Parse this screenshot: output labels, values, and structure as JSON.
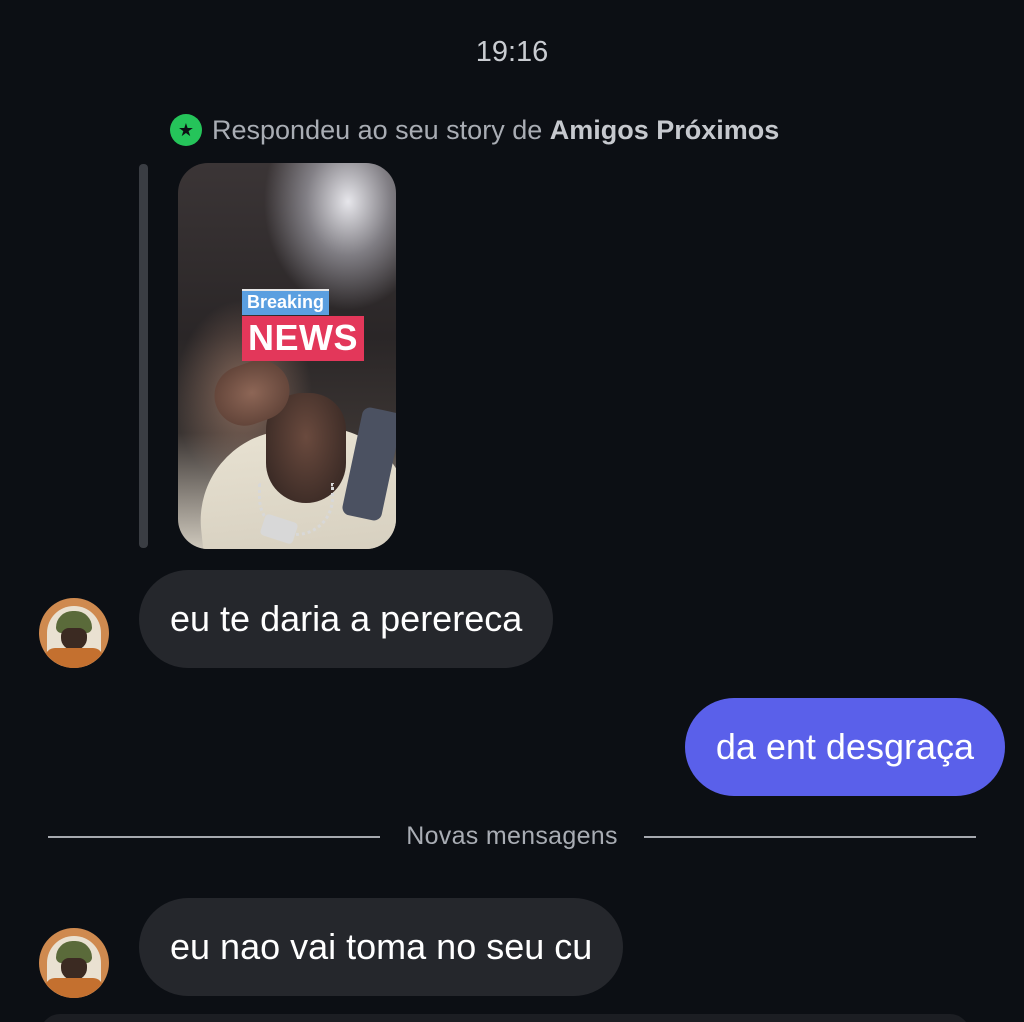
{
  "chat": {
    "timestamp": "19:16",
    "story_reply": {
      "prefix": "Respondeu ao seu story de",
      "audience": "Amigos Próximos",
      "badge_icon": "star-icon",
      "badge_color": "#25c45a",
      "thumbnail": {
        "sticker_top": "Breaking",
        "sticker_main": "NEWS"
      }
    },
    "messages": [
      {
        "direction": "received",
        "text": "eu te daria a perereca"
      },
      {
        "direction": "sent",
        "text": "da ent desgraça"
      },
      {
        "direction": "received",
        "text": "eu nao vai toma no seu cu"
      }
    ],
    "new_messages_divider": "Novas mensagens"
  },
  "colors": {
    "background": "#0c0f14",
    "received_bubble": "#25272c",
    "sent_bubble": "#5a60ea",
    "close_friends_green": "#25c45a"
  }
}
